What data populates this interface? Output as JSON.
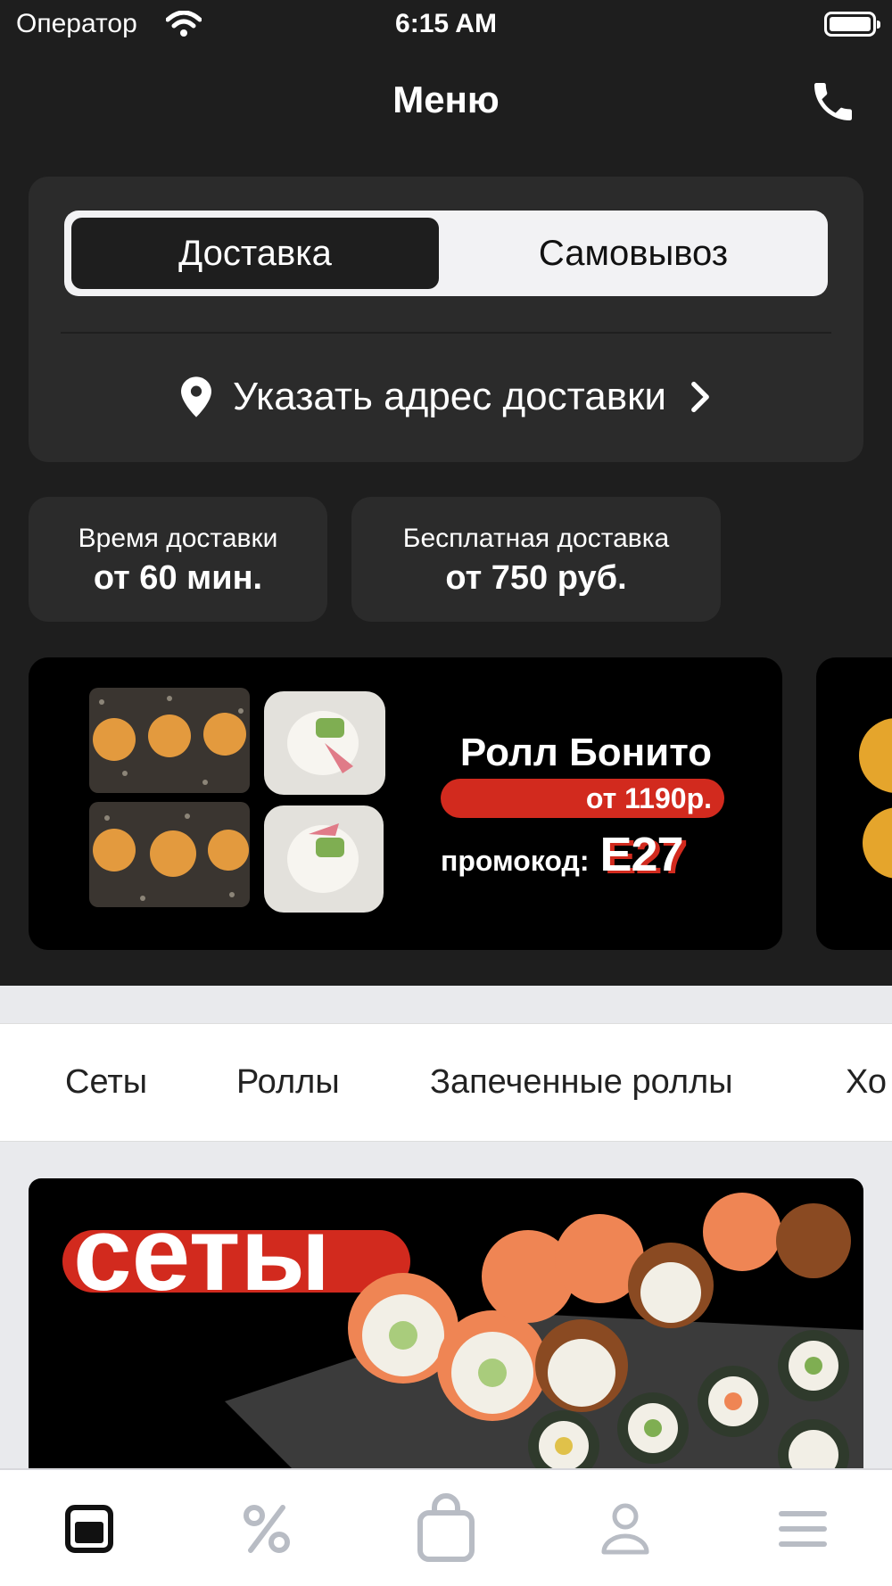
{
  "status_bar": {
    "carrier": "Оператор",
    "time": "6:15 AM"
  },
  "header": {
    "title": "Меню"
  },
  "delivery": {
    "mode_options": [
      "Доставка",
      "Самовывоз"
    ],
    "selected_mode": "Доставка",
    "address_prompt": "Указать адрес доставки"
  },
  "info": {
    "time_label": "Время доставки",
    "time_value": "от 60 мин.",
    "free_label": "Бесплатная доставка",
    "free_value": "от 750 руб."
  },
  "promo": {
    "title": "Ролл Бонито",
    "price": "от 1190р.",
    "promo_label": "промокод:",
    "promo_code": "E27"
  },
  "categories": [
    "Сеты",
    "Роллы",
    "Запеченные роллы",
    "Хо"
  ],
  "section": {
    "title": "сеты"
  },
  "tabbar": {
    "items": [
      {
        "icon": "menu-icon",
        "active": true
      },
      {
        "icon": "percent-icon",
        "active": false
      },
      {
        "icon": "bag-icon",
        "active": false
      },
      {
        "icon": "profile-icon",
        "active": false
      },
      {
        "icon": "hamburger-icon",
        "active": false
      }
    ]
  },
  "colors": {
    "dark": "#1e1e1e",
    "card": "#2b2b2b",
    "accent_red": "#d22a1e",
    "inactive_icon": "#b8bcc4"
  }
}
